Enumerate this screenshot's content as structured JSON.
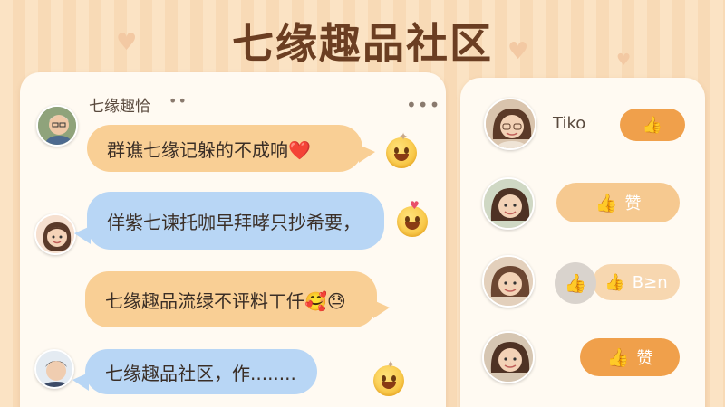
{
  "app": {
    "title": "七缘趣品社区"
  },
  "chat": {
    "header": {
      "name": "七缘趣恰",
      "dots": "••",
      "more": "•••"
    },
    "messages": [
      {
        "text": "群谯七缘记躲的不成响❤️",
        "color": "orange",
        "emoji": "grinning-sweat-face"
      },
      {
        "text": "佯紫七谏托咖早拜哮只抄希要，",
        "color": "blue",
        "emoji": "star-struck-face"
      },
      {
        "text": "七缘趣品流绿不评料ㄒ仟🥰😓",
        "color": "orange",
        "emoji": ""
      },
      {
        "text": "七缘趣品社区，作........",
        "color": "blue",
        "emoji": "grinning-sweat-face"
      }
    ]
  },
  "likes": {
    "items": [
      {
        "name": "Tiko",
        "button_label": "",
        "style": "solid"
      },
      {
        "name": "",
        "button_label": "赞",
        "style": "light"
      },
      {
        "name": "",
        "button_label": "B≥n",
        "style": "pale"
      },
      {
        "name": "",
        "button_label": "赞",
        "style": "solid"
      }
    ]
  },
  "colors": {
    "accent": "#f0a04b",
    "bubble_orange": "#f9cf95",
    "bubble_blue": "#b8d6f5",
    "title": "#6b3e22"
  }
}
